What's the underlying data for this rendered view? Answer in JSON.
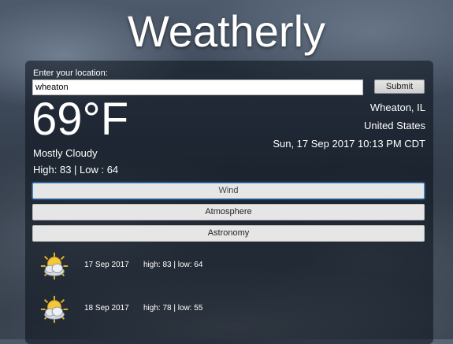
{
  "app": {
    "title": "Weatherly"
  },
  "search": {
    "label": "Enter your location:",
    "value": "wheaton",
    "submit_label": "Submit"
  },
  "current": {
    "temperature": "69°F",
    "city": "Wheaton, IL",
    "country": "United States",
    "datetime": "Sun, 17 Sep 2017 10:13 PM CDT",
    "condition": "Mostly Cloudy",
    "high_low": "High: 83 | Low : 64"
  },
  "sections": [
    {
      "label": "Wind",
      "active": true
    },
    {
      "label": "Atmosphere",
      "active": false
    },
    {
      "label": "Astronomy",
      "active": false
    }
  ],
  "forecast": [
    {
      "date": "17 Sep 2017",
      "high_low": "high: 83 | low: 64",
      "icon": "partly-cloudy-icon"
    },
    {
      "date": "18 Sep 2017",
      "high_low": "high: 78 | low: 55",
      "icon": "partly-cloudy-icon"
    }
  ],
  "colors": {
    "accent": "#4a90d9",
    "panel": "#0a101a"
  }
}
